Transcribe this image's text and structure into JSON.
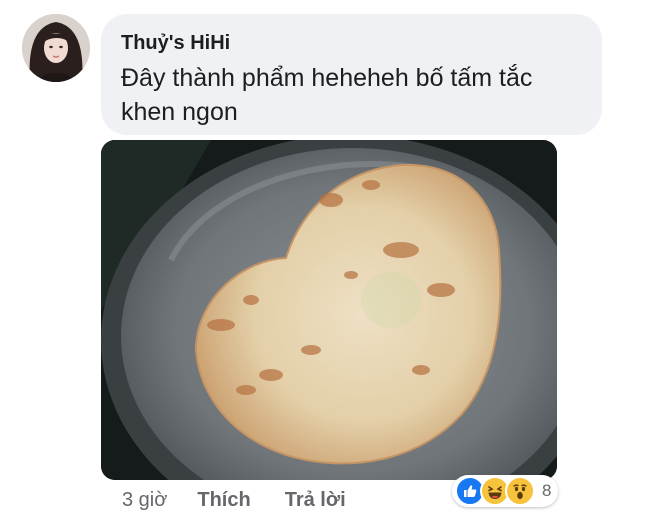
{
  "comment": {
    "author": "Thuỷ's HiHi",
    "text": "Đây thành phẩm heheheh bố tấm tắc khen ngon"
  },
  "actions": {
    "time": "3 giờ",
    "like_label": "Thích",
    "reply_label": "Trả lời"
  },
  "reactions": {
    "icons": [
      "like-icon",
      "haha-icon",
      "wow-icon"
    ],
    "count": "8"
  },
  "colors": {
    "bubble": "#f0f1f4",
    "like_blue": "#1877f2",
    "reaction_yellow": "#f7c33c",
    "meta_text": "#65676b"
  }
}
